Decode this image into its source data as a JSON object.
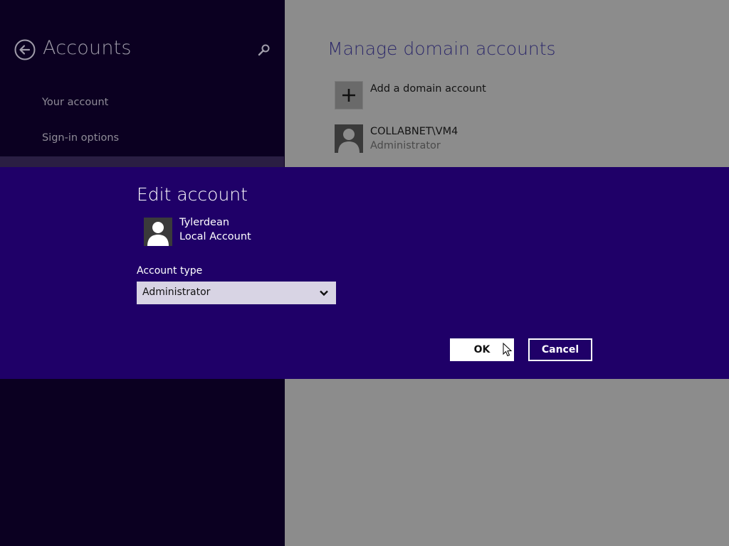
{
  "sidebar": {
    "title": "Accounts",
    "back_icon": "back-arrow-icon",
    "search_icon": "search-icon",
    "items": [
      {
        "label": "Your account"
      },
      {
        "label": "Sign-in options"
      }
    ]
  },
  "content": {
    "heading": "Manage domain accounts",
    "add_account": {
      "label": "Add a domain account",
      "icon": "plus-icon"
    },
    "accounts": [
      {
        "name": "COLLABNET\\VM4",
        "role": "Administrator",
        "icon": "user-avatar-icon"
      }
    ]
  },
  "dialog": {
    "title": "Edit account",
    "user": {
      "name": "Tylerdean",
      "type": "Local Account",
      "icon": "user-avatar-icon"
    },
    "account_type_label": "Account type",
    "account_type_value": "Administrator",
    "ok_label": "OK",
    "cancel_label": "Cancel"
  },
  "colors": {
    "dialog_bg": "#1f0068",
    "sidebar_bg": "#0b0021",
    "content_bg": "#8c8c8c",
    "heading": "#2e2a6a"
  }
}
